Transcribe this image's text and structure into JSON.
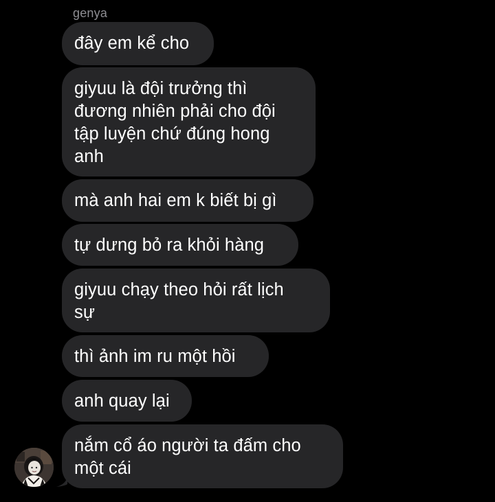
{
  "conversation": {
    "sender_name": "genya",
    "bubble_color": "#262628",
    "background_color": "#000000",
    "avatar_icon": "user-avatar-icon",
    "messages": [
      {
        "lines": [
          "đây em kể cho"
        ]
      },
      {
        "lines": [
          "giyuu là đội trưởng thì",
          "đương nhiên phải cho đội",
          "tập luyện chứ đúng hong",
          "anh"
        ]
      },
      {
        "lines": [
          "mà anh hai em k biết bị gì"
        ]
      },
      {
        "lines": [
          "tự dưng bỏ ra khỏi hàng"
        ]
      },
      {
        "lines": [
          "giyuu chạy theo hỏi rất lịch",
          "sự"
        ]
      },
      {
        "lines": [
          "thì ảnh im ru một hồi"
        ]
      },
      {
        "lines": [
          "anh quay lại"
        ]
      },
      {
        "lines": [
          "nắm cổ áo người ta đấm cho",
          "một cái"
        ]
      }
    ]
  }
}
